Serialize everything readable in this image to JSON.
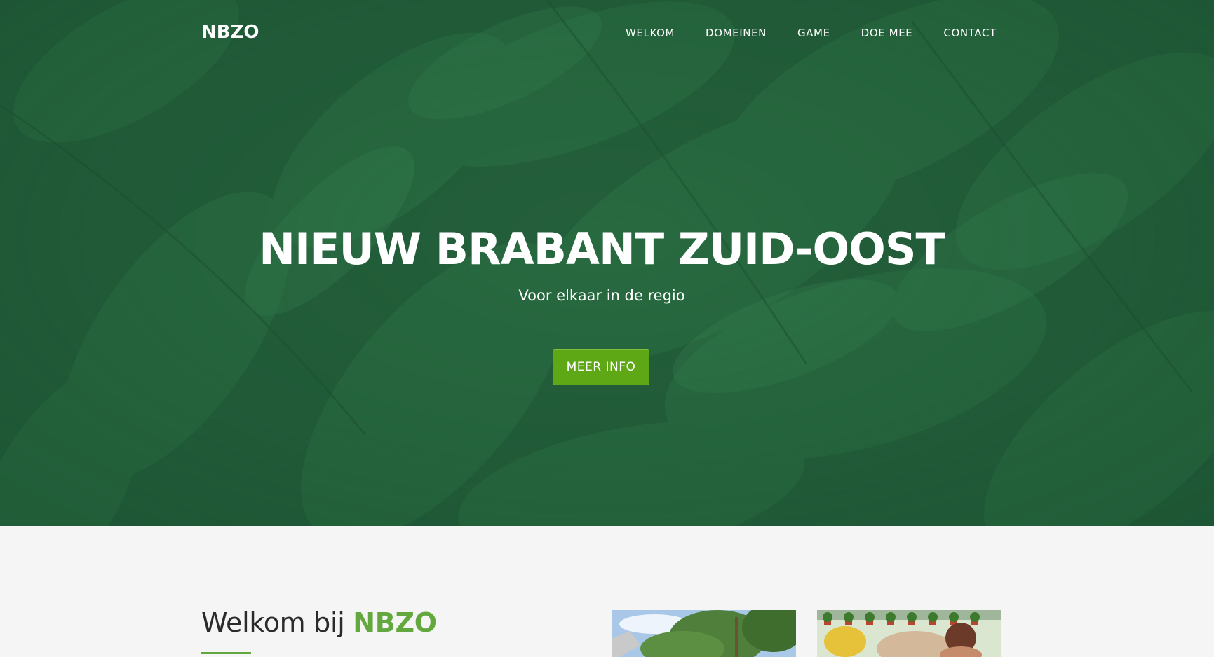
{
  "nav": {
    "brand": "NBZO",
    "items": [
      {
        "label": "WELKOM"
      },
      {
        "label": "DOMEINEN"
      },
      {
        "label": "GAME"
      },
      {
        "label": "DOE MEE"
      },
      {
        "label": "CONTACT"
      }
    ]
  },
  "hero": {
    "title": "NIEUW BRABANT ZUID-OOST",
    "subtitle": "Voor elkaar in de regio",
    "cta_label": "MEER INFO",
    "background": "green-leaves-photo"
  },
  "welcome": {
    "title_prefix": "Welkom bij ",
    "title_accent": "NBZO"
  },
  "colors": {
    "hero_green": "#24613a",
    "accent_green": "#62a83f",
    "button_green": "#5fa815",
    "text_dark": "#2b2b2b",
    "section_bg": "#f5f5f5"
  }
}
